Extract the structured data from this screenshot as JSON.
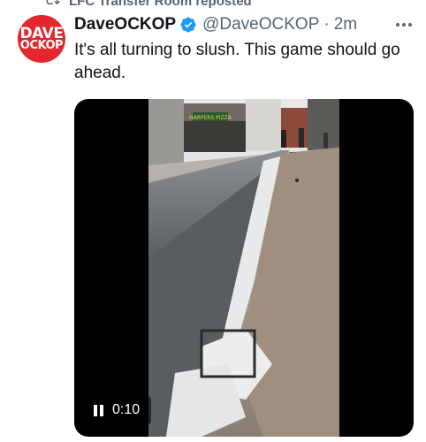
{
  "repost": {
    "text": "LFC Transfer Room reposted",
    "icon": "repost-icon"
  },
  "author": {
    "avatar_line1": "DAVE",
    "avatar_line2": "OCKOP",
    "avatar_color": "#e3262b",
    "display_name": "DaveOCKOP",
    "verified_icon": "verified-badge-icon",
    "verified_color": "#1d9bf0",
    "handle": "@DaveOCKOP",
    "separator": "·",
    "time": "2m"
  },
  "more_icon": "more-options-icon",
  "tweet": {
    "text": "It's all turning to slush. This game should go ahead."
  },
  "video": {
    "time": "0:10",
    "state_icon": "pause-icon",
    "sign_text": "HARPERS PIZZA"
  }
}
